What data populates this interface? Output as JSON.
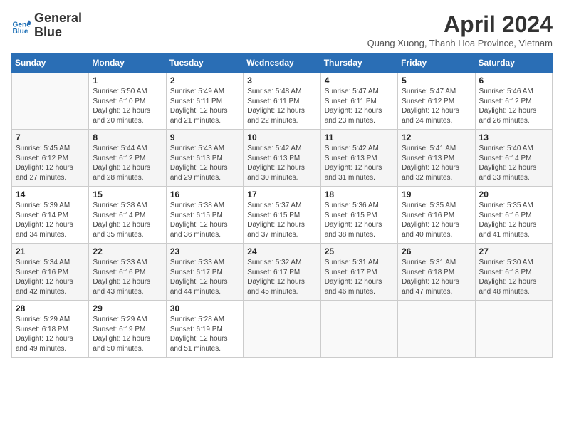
{
  "logo": {
    "line1": "General",
    "line2": "Blue"
  },
  "title": "April 2024",
  "subtitle": "Quang Xuong, Thanh Hoa Province, Vietnam",
  "weekdays": [
    "Sunday",
    "Monday",
    "Tuesday",
    "Wednesday",
    "Thursday",
    "Friday",
    "Saturday"
  ],
  "weeks": [
    [
      {
        "num": "",
        "info": ""
      },
      {
        "num": "1",
        "info": "Sunrise: 5:50 AM\nSunset: 6:10 PM\nDaylight: 12 hours\nand 20 minutes."
      },
      {
        "num": "2",
        "info": "Sunrise: 5:49 AM\nSunset: 6:11 PM\nDaylight: 12 hours\nand 21 minutes."
      },
      {
        "num": "3",
        "info": "Sunrise: 5:48 AM\nSunset: 6:11 PM\nDaylight: 12 hours\nand 22 minutes."
      },
      {
        "num": "4",
        "info": "Sunrise: 5:47 AM\nSunset: 6:11 PM\nDaylight: 12 hours\nand 23 minutes."
      },
      {
        "num": "5",
        "info": "Sunrise: 5:47 AM\nSunset: 6:12 PM\nDaylight: 12 hours\nand 24 minutes."
      },
      {
        "num": "6",
        "info": "Sunrise: 5:46 AM\nSunset: 6:12 PM\nDaylight: 12 hours\nand 26 minutes."
      }
    ],
    [
      {
        "num": "7",
        "info": "Sunrise: 5:45 AM\nSunset: 6:12 PM\nDaylight: 12 hours\nand 27 minutes."
      },
      {
        "num": "8",
        "info": "Sunrise: 5:44 AM\nSunset: 6:12 PM\nDaylight: 12 hours\nand 28 minutes."
      },
      {
        "num": "9",
        "info": "Sunrise: 5:43 AM\nSunset: 6:13 PM\nDaylight: 12 hours\nand 29 minutes."
      },
      {
        "num": "10",
        "info": "Sunrise: 5:42 AM\nSunset: 6:13 PM\nDaylight: 12 hours\nand 30 minutes."
      },
      {
        "num": "11",
        "info": "Sunrise: 5:42 AM\nSunset: 6:13 PM\nDaylight: 12 hours\nand 31 minutes."
      },
      {
        "num": "12",
        "info": "Sunrise: 5:41 AM\nSunset: 6:13 PM\nDaylight: 12 hours\nand 32 minutes."
      },
      {
        "num": "13",
        "info": "Sunrise: 5:40 AM\nSunset: 6:14 PM\nDaylight: 12 hours\nand 33 minutes."
      }
    ],
    [
      {
        "num": "14",
        "info": "Sunrise: 5:39 AM\nSunset: 6:14 PM\nDaylight: 12 hours\nand 34 minutes."
      },
      {
        "num": "15",
        "info": "Sunrise: 5:38 AM\nSunset: 6:14 PM\nDaylight: 12 hours\nand 35 minutes."
      },
      {
        "num": "16",
        "info": "Sunrise: 5:38 AM\nSunset: 6:15 PM\nDaylight: 12 hours\nand 36 minutes."
      },
      {
        "num": "17",
        "info": "Sunrise: 5:37 AM\nSunset: 6:15 PM\nDaylight: 12 hours\nand 37 minutes."
      },
      {
        "num": "18",
        "info": "Sunrise: 5:36 AM\nSunset: 6:15 PM\nDaylight: 12 hours\nand 38 minutes."
      },
      {
        "num": "19",
        "info": "Sunrise: 5:35 AM\nSunset: 6:16 PM\nDaylight: 12 hours\nand 40 minutes."
      },
      {
        "num": "20",
        "info": "Sunrise: 5:35 AM\nSunset: 6:16 PM\nDaylight: 12 hours\nand 41 minutes."
      }
    ],
    [
      {
        "num": "21",
        "info": "Sunrise: 5:34 AM\nSunset: 6:16 PM\nDaylight: 12 hours\nand 42 minutes."
      },
      {
        "num": "22",
        "info": "Sunrise: 5:33 AM\nSunset: 6:16 PM\nDaylight: 12 hours\nand 43 minutes."
      },
      {
        "num": "23",
        "info": "Sunrise: 5:33 AM\nSunset: 6:17 PM\nDaylight: 12 hours\nand 44 minutes."
      },
      {
        "num": "24",
        "info": "Sunrise: 5:32 AM\nSunset: 6:17 PM\nDaylight: 12 hours\nand 45 minutes."
      },
      {
        "num": "25",
        "info": "Sunrise: 5:31 AM\nSunset: 6:17 PM\nDaylight: 12 hours\nand 46 minutes."
      },
      {
        "num": "26",
        "info": "Sunrise: 5:31 AM\nSunset: 6:18 PM\nDaylight: 12 hours\nand 47 minutes."
      },
      {
        "num": "27",
        "info": "Sunrise: 5:30 AM\nSunset: 6:18 PM\nDaylight: 12 hours\nand 48 minutes."
      }
    ],
    [
      {
        "num": "28",
        "info": "Sunrise: 5:29 AM\nSunset: 6:18 PM\nDaylight: 12 hours\nand 49 minutes."
      },
      {
        "num": "29",
        "info": "Sunrise: 5:29 AM\nSunset: 6:19 PM\nDaylight: 12 hours\nand 50 minutes."
      },
      {
        "num": "30",
        "info": "Sunrise: 5:28 AM\nSunset: 6:19 PM\nDaylight: 12 hours\nand 51 minutes."
      },
      {
        "num": "",
        "info": ""
      },
      {
        "num": "",
        "info": ""
      },
      {
        "num": "",
        "info": ""
      },
      {
        "num": "",
        "info": ""
      }
    ]
  ]
}
